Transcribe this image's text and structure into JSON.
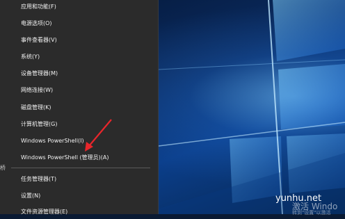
{
  "menu": {
    "items": [
      {
        "label": "应用和功能(F)"
      },
      {
        "label": "电源选项(O)"
      },
      {
        "label": "事件查看器(V)"
      },
      {
        "label": "系统(Y)"
      },
      {
        "label": "设备管理器(M)"
      },
      {
        "label": "网络连接(W)"
      },
      {
        "label": "磁盘管理(K)"
      },
      {
        "label": "计算机管理(G)"
      },
      {
        "label": "Windows PowerShell(I)"
      },
      {
        "label": "Windows PowerShell (管理员)(A)"
      },
      {
        "label": "任务管理器(T)"
      },
      {
        "label": "设置(N)"
      },
      {
        "label": "文件资源管理器(E)"
      }
    ]
  },
  "left_strip": {
    "text": "桥"
  },
  "watermark": {
    "site": "yunhu.net",
    "activate": "激活 Windo",
    "activate_sub": "转到\"设置\"以激活"
  },
  "colors": {
    "menu_bg": "#2b2b2b",
    "menu_text": "#f2f2f2",
    "arrow": "#e8262b"
  }
}
